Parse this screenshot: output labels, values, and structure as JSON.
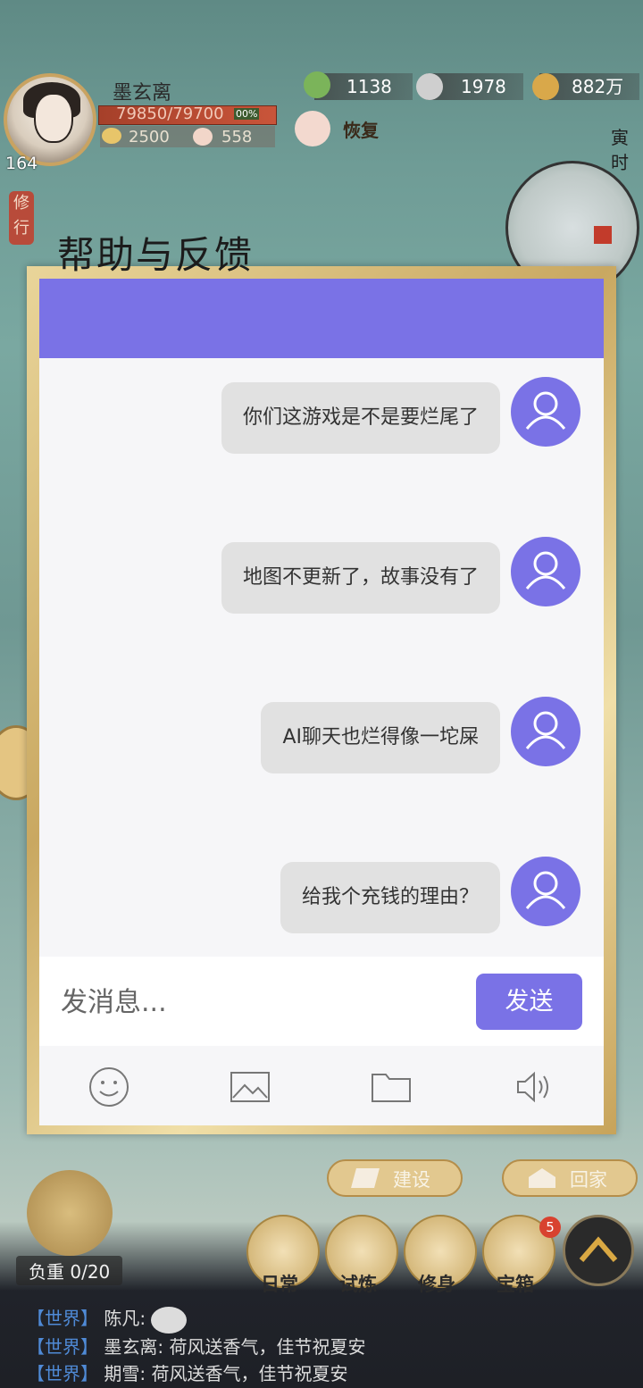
{
  "hud": {
    "player_name": "墨玄离",
    "level": "164",
    "hp_text": "79850/79700",
    "hp_percent_label": "00%",
    "stat_a": "2500",
    "stat_b": "558",
    "res_1": "1138",
    "res_2": "1978",
    "res_3": "882万",
    "restore_label": "恢复",
    "time_label": "寅时",
    "side_tag": "修行"
  },
  "dialog": {
    "title": "帮助与反馈",
    "messages": [
      {
        "text": "你们这游戏是不是要烂尾了"
      },
      {
        "text": "地图不更新了，故事没有了"
      },
      {
        "text": "AI聊天也烂得像一坨屎"
      },
      {
        "text": "给我个充钱的理由？"
      }
    ],
    "input_placeholder": "发消息...",
    "send_label": "发送",
    "toolbar_icons": [
      "smile-icon",
      "image-icon",
      "folder-icon",
      "speaker-icon"
    ],
    "accent_color": "#7a72e6"
  },
  "bottom": {
    "build_label": "建设",
    "home_label": "回家",
    "weight_label": "负重 0/20",
    "nav": [
      {
        "label": "日常"
      },
      {
        "label": "试炼"
      },
      {
        "label": "修身"
      },
      {
        "label": "宝箱"
      }
    ],
    "treasure_badge": "5"
  },
  "chat": [
    {
      "channel": "【世界】",
      "text": "陈凡:"
    },
    {
      "channel": "【世界】",
      "text": "墨玄离: 荷风送香气，佳节祝夏安"
    },
    {
      "channel": "【世界】",
      "text": "期雪: 荷风送香气，佳节祝夏安"
    }
  ]
}
